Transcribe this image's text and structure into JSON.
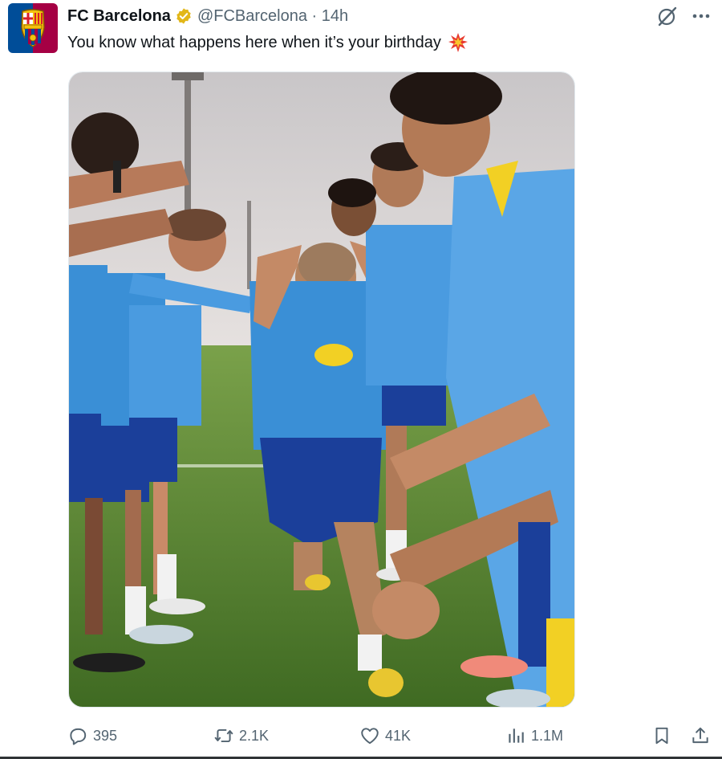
{
  "post": {
    "display_name": "FC Barcelona",
    "handle": "@FCBarcelona",
    "separator": "·",
    "time": "14h",
    "text": "You know what happens here when it’s your birthday",
    "emoji_icon": "collision-icon",
    "media_description": ""
  },
  "actions": {
    "replies": "395",
    "reposts": "2.1K",
    "likes": "41K",
    "views": "1.1M"
  },
  "colors": {
    "text": "#0f1419",
    "muted": "#536471",
    "verified_gold": "#e2b719",
    "barca_blue": "#004d98",
    "barca_red": "#a50044",
    "jersey_blue": "#3a8fd6",
    "shorts_blue": "#1b3f9a",
    "grass": "#4e7d2c"
  },
  "icons": {
    "grok": "grok-icon",
    "more": "more-icon",
    "reply": "reply-icon",
    "repost": "repost-icon",
    "like": "heart-icon",
    "views": "views-icon",
    "bookmark": "bookmark-icon",
    "share": "share-icon"
  }
}
